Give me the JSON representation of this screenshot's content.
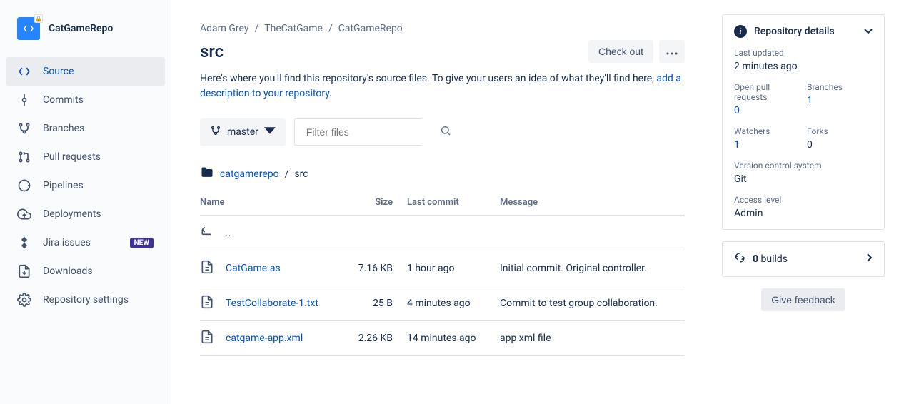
{
  "sidebar": {
    "repo_name": "CatGameRepo",
    "items": [
      {
        "label": "Source"
      },
      {
        "label": "Commits"
      },
      {
        "label": "Branches"
      },
      {
        "label": "Pull requests"
      },
      {
        "label": "Pipelines"
      },
      {
        "label": "Deployments"
      },
      {
        "label": "Jira issues",
        "badge": "NEW"
      },
      {
        "label": "Downloads"
      },
      {
        "label": "Repository settings"
      }
    ]
  },
  "breadcrumbs": {
    "owner": "Adam Grey",
    "project": "TheCatGame",
    "repo": "CatGameRepo"
  },
  "page_title": "src",
  "actions": {
    "checkout": "Check out"
  },
  "description": {
    "text": "Here's where you'll find this repository's source files. To give your users an idea of what they'll find here, ",
    "link": "add a description to your repository"
  },
  "branch_selector": {
    "value": "master"
  },
  "filter": {
    "placeholder": "Filter files"
  },
  "path": {
    "root": "catgamerepo",
    "current": "src"
  },
  "table": {
    "headers": {
      "name": "Name",
      "size": "Size",
      "last_commit": "Last commit",
      "message": "Message"
    },
    "parent": "..",
    "rows": [
      {
        "name": "CatGame.as",
        "size": "7.16 KB",
        "last_commit": "1 hour ago",
        "message": "Initial commit. Original controller."
      },
      {
        "name": "TestCollaborate-1.txt",
        "size": "25 B",
        "last_commit": "4 minutes ago",
        "message": "Commit to test group collaboration."
      },
      {
        "name": "catgame-app.xml",
        "size": "2.26 KB",
        "last_commit": "14 minutes ago",
        "message": "app xml file"
      }
    ]
  },
  "details": {
    "title": "Repository details",
    "last_updated": {
      "label": "Last updated",
      "value": "2 minutes ago"
    },
    "pull_requests": {
      "label": "Open pull requests",
      "value": "0"
    },
    "branches": {
      "label": "Branches",
      "value": "1"
    },
    "watchers": {
      "label": "Watchers",
      "value": "1"
    },
    "forks": {
      "label": "Forks",
      "value": "0"
    },
    "vcs": {
      "label": "Version control system",
      "value": "Git"
    },
    "access": {
      "label": "Access level",
      "value": "Admin"
    }
  },
  "builds": {
    "count": "0",
    "label": " builds"
  },
  "feedback": "Give feedback"
}
